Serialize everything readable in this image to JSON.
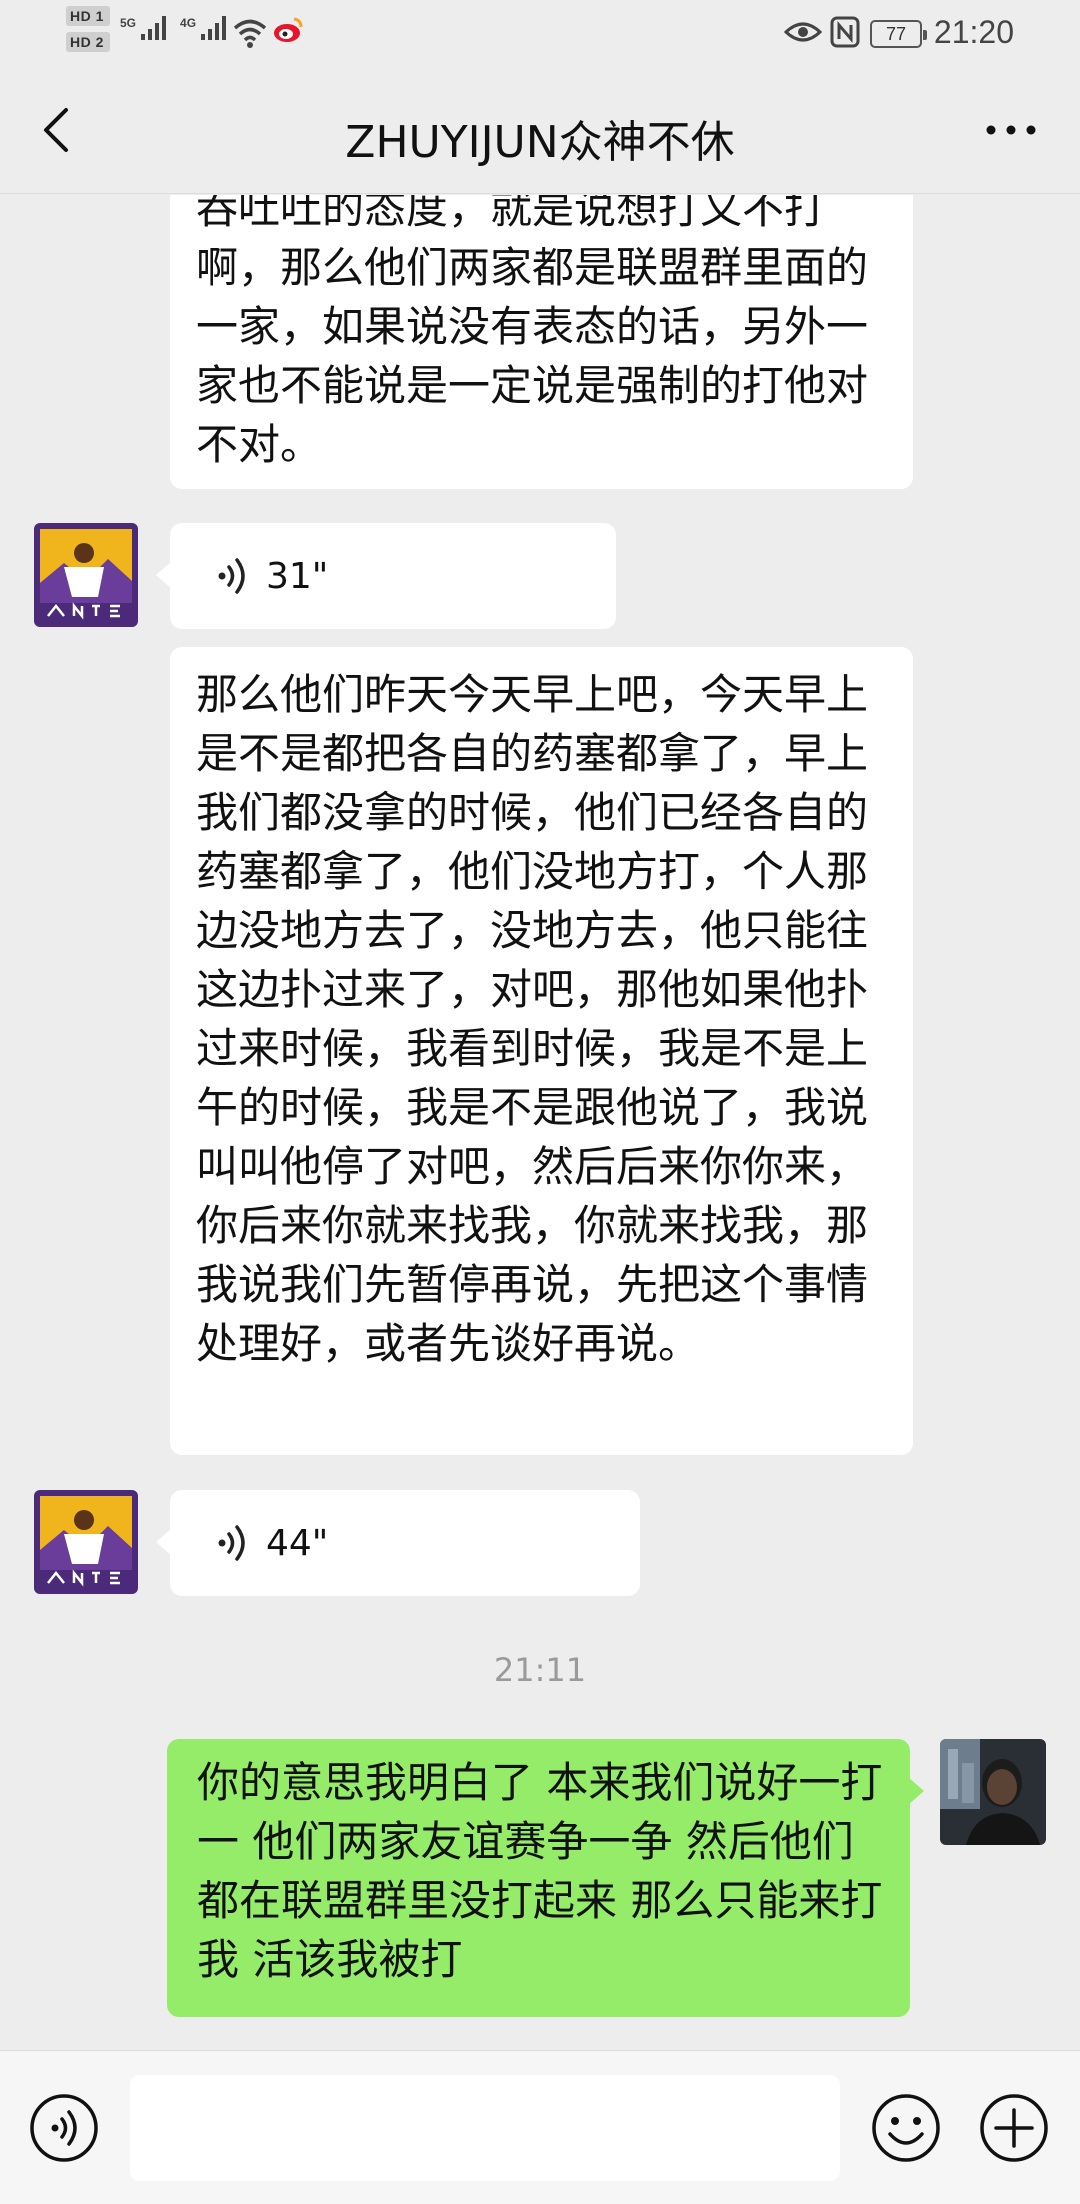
{
  "status_bar": {
    "hd1": "HD 1",
    "hd2": "HD 2",
    "net1": "5G",
    "net2": "4G",
    "battery": "77",
    "time": "21:20"
  },
  "nav": {
    "title": "ZHUYIJUN众神不休"
  },
  "messages": [
    {
      "side": "left",
      "type": "text",
      "text": "吞吐吐的态度，就是说想打又不打啊，那么他们两家都是联盟群里面的一家，如果说没有表态的话，另外一家也不能说是一定说是强制的打他对不对。"
    },
    {
      "side": "left",
      "type": "voice",
      "duration": "31\""
    },
    {
      "side": "left",
      "type": "text",
      "text": "那么他们昨天今天早上吧，今天早上是不是都把各自的药塞都拿了，早上我们都没拿的时候，他们已经各自的药塞都拿了，他们没地方打，个人那边没地方去了，没地方去，他只能往这边扑过来了，对吧，那他如果他扑过来时候，我看到时候，我是不是上午的时候，我是不是跟他说了，我说叫叫他停了对吧，然后后来你你来，你后来你就来找我，你就来找我，那我说我们先暂停再说，先把这个事情处理好，或者先谈好再说。"
    },
    {
      "side": "left",
      "type": "voice",
      "duration": "44\""
    },
    {
      "type": "time",
      "text": "21:11"
    },
    {
      "side": "right",
      "type": "text",
      "text": "你的意思我明白了 本来我们说好一打一 他们两家友谊赛争一争  然后他们都在联盟群里没打起来 那么只能来打我  活该我被打"
    }
  ],
  "colors": {
    "background": "#ededed",
    "bubble_in": "#ffffff",
    "bubble_out": "#95ec69"
  },
  "icons": {
    "back": "chevron-left-icon",
    "more": "more-dots-icon",
    "voice": "voice-wave-icon",
    "emoji": "smile-icon",
    "add": "plus-circle-icon"
  }
}
